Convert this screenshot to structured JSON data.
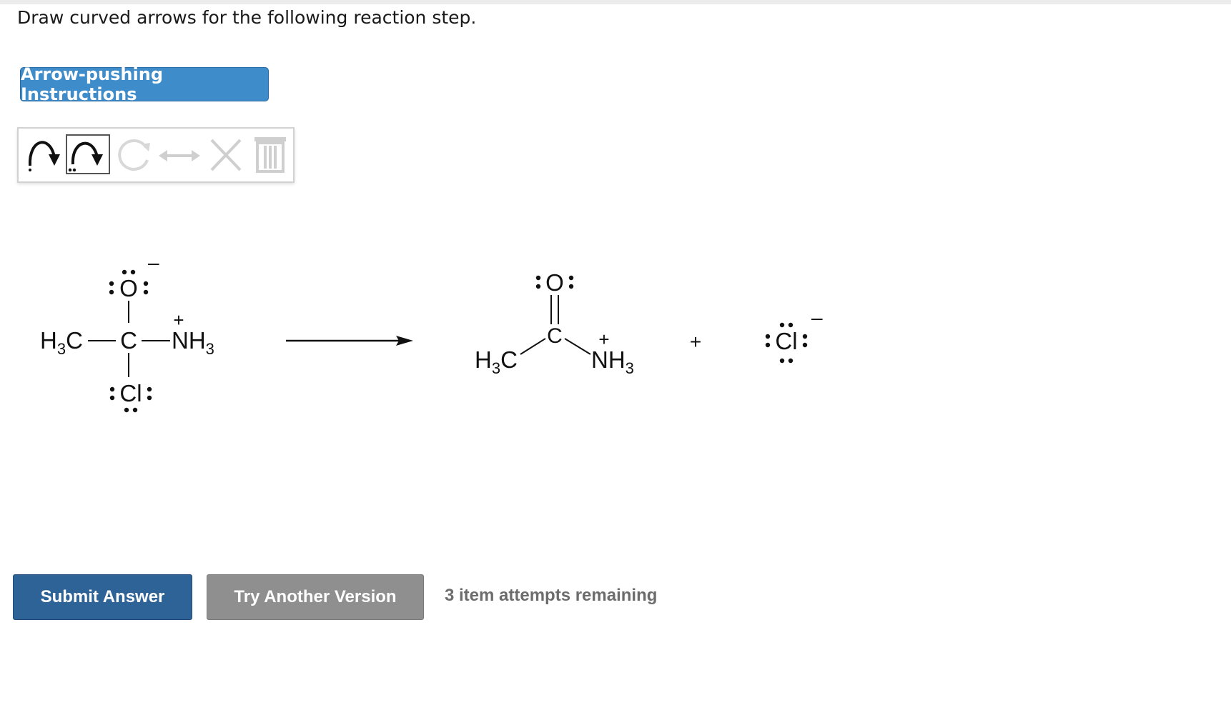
{
  "question": {
    "text": "Draw curved arrows for the following reaction step."
  },
  "instructions_button": {
    "label": "Arrow-pushing Instructions"
  },
  "toolbar": {
    "tools": [
      "electron-pair-arrow-icon",
      "lone-pair-arrow-icon",
      "rotate-icon",
      "resonance-arrow-icon",
      "delete-x-icon",
      "trash-icon"
    ]
  },
  "reactant": {
    "oxygen": "O",
    "carbon": "C",
    "methyl": [
      "H",
      "3",
      "C"
    ],
    "ammonium": [
      "NH",
      "3"
    ],
    "chlorine": "Cl",
    "minus": "–",
    "plus": "+"
  },
  "product": {
    "oxygen": "O",
    "carbon": "C",
    "methyl": [
      "H",
      "3",
      "C"
    ],
    "ammonium": [
      "NH",
      "3"
    ],
    "plus_charge": "+"
  },
  "plus_sign": "+",
  "chloride": {
    "symbol": "Cl",
    "minus": "–"
  },
  "actions": {
    "submit_label": "Submit Answer",
    "try_label": "Try Another Version",
    "attempts_text": "3 item attempts remaining"
  },
  "colors": {
    "accent_blue": "#3f8ccb",
    "submit_blue": "#2e6398",
    "try_gray": "#8f8f8f"
  }
}
